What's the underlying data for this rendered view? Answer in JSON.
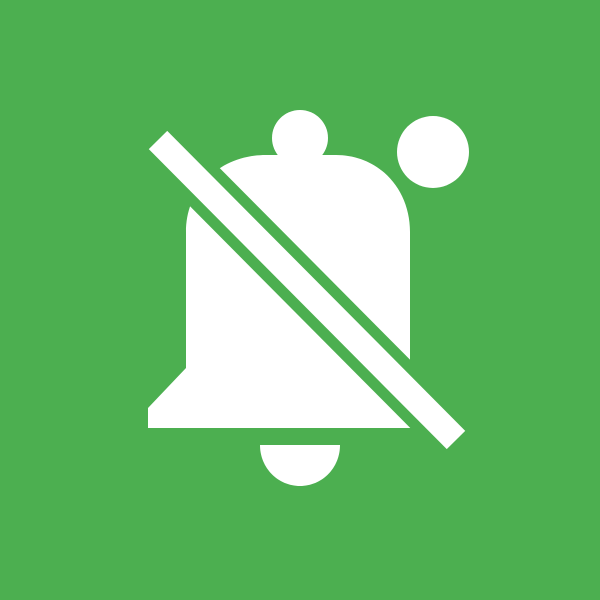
{
  "icon": {
    "name": "notifications-off-icon",
    "indicator": "dot-icon",
    "background_color": "#4CAF50",
    "foreground_color": "#FFFFFF"
  }
}
